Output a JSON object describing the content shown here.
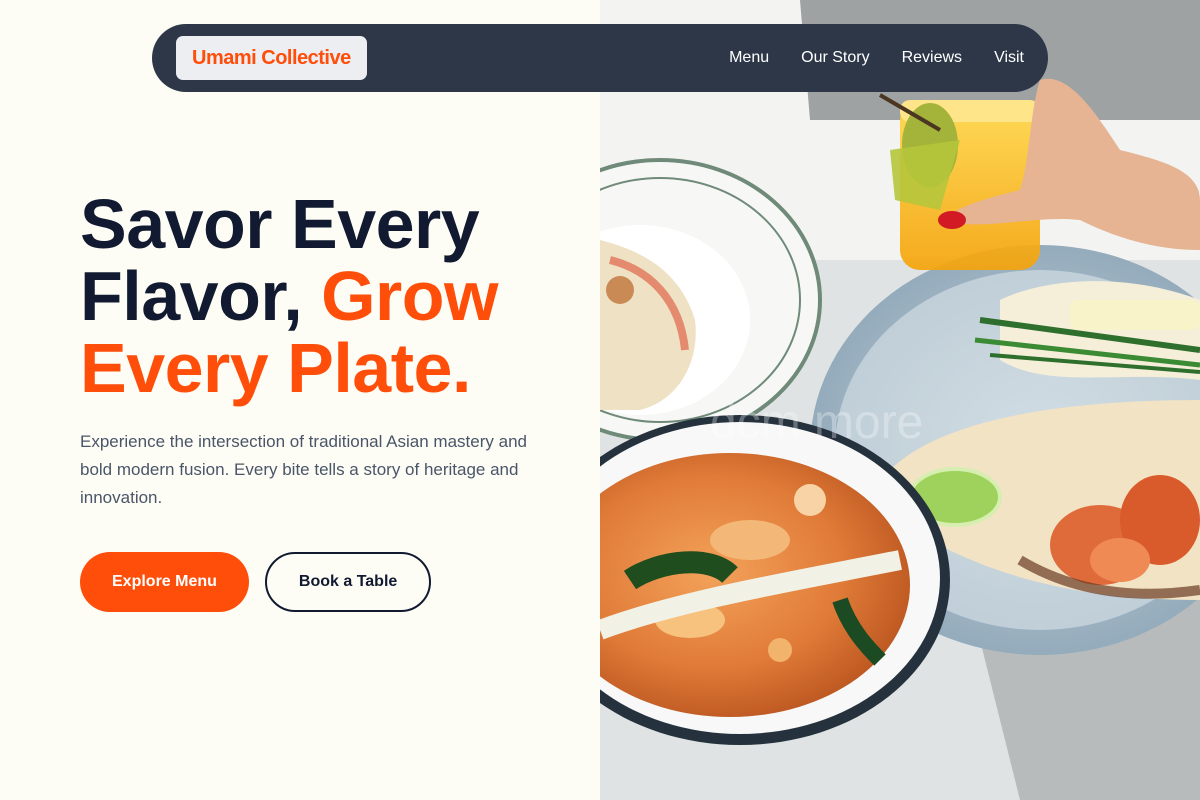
{
  "brand": {
    "name": "Umami Collective",
    "accent_color": "#ff4d0a",
    "dark_color": "#111a30",
    "nav_background": "#2d3748"
  },
  "nav": {
    "links": [
      "Menu",
      "Our Story",
      "Reviews",
      "Visit"
    ]
  },
  "hero": {
    "headline_line1": "Savor Every",
    "headline_line2_dark": "Flavor, ",
    "headline_line2_accent": "Grow",
    "headline_line3_accent": "Every Plate.",
    "description": "Experience the intersection of traditional Asian mastery and bold modern fusion. Every bite tells a story of heritage and innovation.",
    "primary_cta": "Explore Menu",
    "secondary_cta": "Book a Table"
  },
  "photo": {
    "subject": "food-photo",
    "watermark": "dcm more"
  }
}
